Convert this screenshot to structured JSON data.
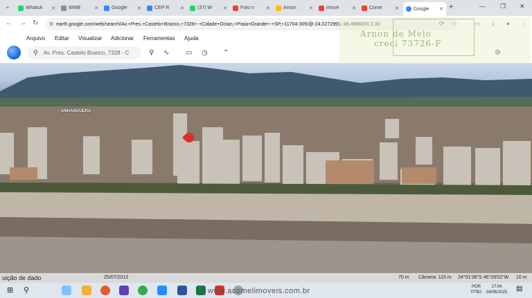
{
  "browser": {
    "tabs": [
      {
        "label": "WhatsA",
        "color": "#25d366"
      },
      {
        "label": "WMB",
        "color": "#8e8e8e"
      },
      {
        "label": "Google",
        "color": "#4285f4"
      },
      {
        "label": "CEP R",
        "color": "#4285f4"
      },
      {
        "label": "(37) W",
        "color": "#25d366"
      },
      {
        "label": "Foto n",
        "color": "#ea4335"
      },
      {
        "label": "Arnon",
        "color": "#fbbc04"
      },
      {
        "label": "imove",
        "color": "#ea4335"
      },
      {
        "label": "Come",
        "color": "#ea4335"
      },
      {
        "label": "Google",
        "color": "#4285f4"
      }
    ],
    "url": "earth.google.com/web/search/Av.+Pres.+Castelo+Branco,+7328+-+Cidade+Ocian,+Praia+Grande+-+SP,+11704-305/@-24.0272991,-46.4696001 2.33"
  },
  "menu": {
    "items": [
      "Arquivo",
      "Editar",
      "Visualizar",
      "Adicionar",
      "Ferramentas",
      "Ajuda"
    ]
  },
  "earth": {
    "search_value": "Av. Pres. Castelo Branco, 7328 - C",
    "map_label": "ANHANGUERA"
  },
  "watermark": {
    "line1": "Arnon de Melo",
    "line2": "creci 73726-F"
  },
  "status": {
    "attribution": "uição de dado",
    "date": "25/07/2013",
    "scale": "70 m",
    "camera": "Câmera: 115 m",
    "coords": "24°01'38\"S 46°28'02\"W",
    "elevation": "10 m"
  },
  "taskbar": {
    "site": "www.acomelimoveis.com.br",
    "lang1": "POR",
    "lang2": "PTB2",
    "time": "17:04",
    "date": "04/06/2025"
  },
  "colors": {
    "accent": "#1a73e8",
    "marker": "#d93025"
  }
}
